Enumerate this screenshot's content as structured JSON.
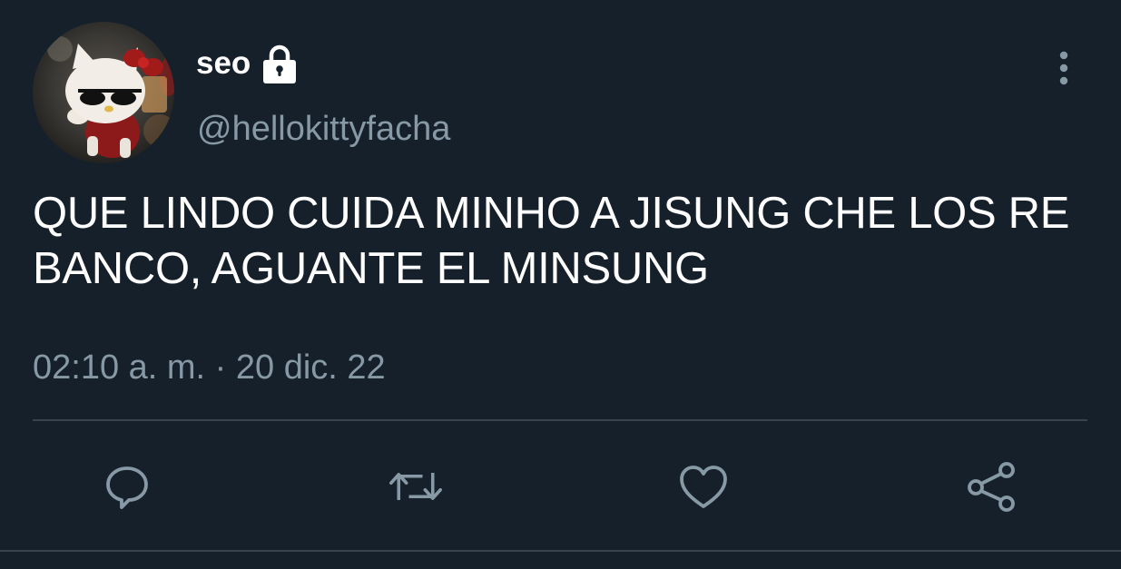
{
  "tweet": {
    "display_name": "seo",
    "username": "@hellokittyfacha",
    "text": "QUE LINDO CUIDA MINHO A JISUNG CHE LOS RE BANCO, AGUANTE EL MINSUNG",
    "timestamp": "02:10 a. m. · 20 dic. 22",
    "protected": true
  },
  "icons": {
    "lock": "lock-icon",
    "more": "more-vertical-icon",
    "reply": "reply-icon",
    "retweet": "retweet-icon",
    "like": "heart-icon",
    "share": "share-icon"
  },
  "colors": {
    "background": "#15202b",
    "primary_text": "#ffffff",
    "secondary_text": "#8899a6",
    "divider": "#38444d"
  }
}
